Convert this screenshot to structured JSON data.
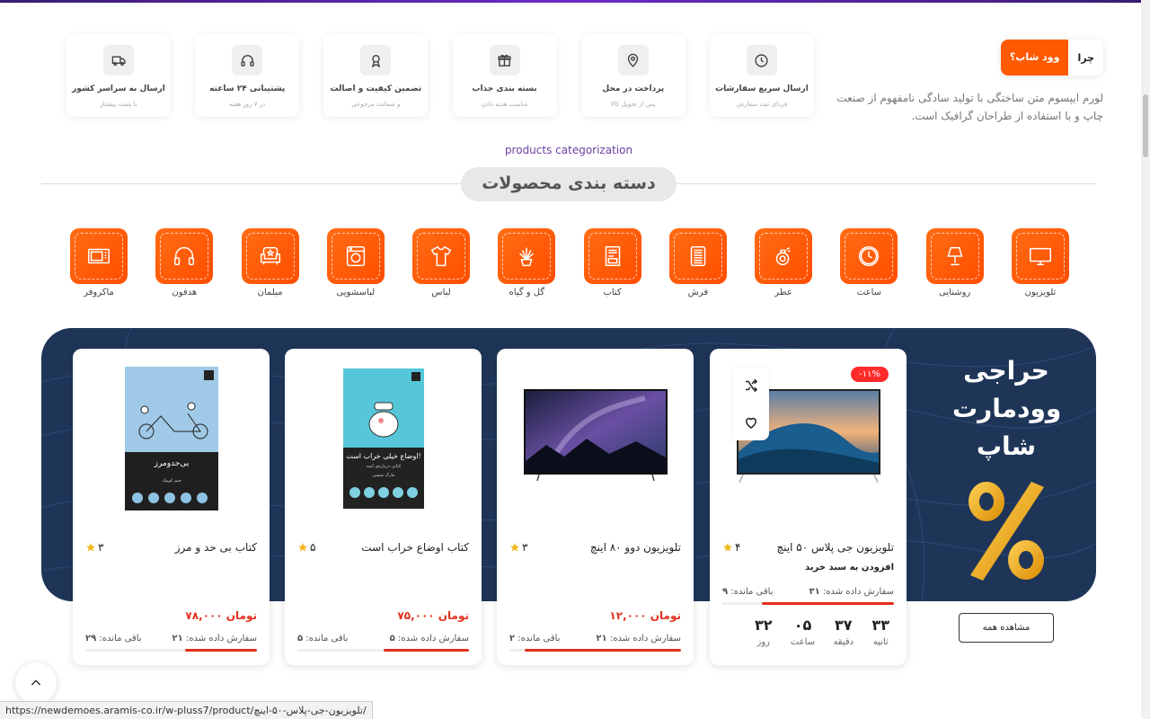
{
  "features": [
    {
      "icon": "clock-icon",
      "title": "ارسال سریع سفارشات",
      "subtitle": "فردای ثبت سفارش"
    },
    {
      "icon": "location-pin-icon",
      "title": "پرداخت در محل",
      "subtitle": "پس از تحویل کالا"
    },
    {
      "icon": "gift-icon",
      "title": "بسته بندی جذاب",
      "subtitle": "مناسب هدیه دادن"
    },
    {
      "icon": "award-icon",
      "title": "تضمین کیفیت و اصالت",
      "subtitle": "و ضمانت مرجوعی"
    },
    {
      "icon": "headphones-icon",
      "title": "پشتیبانی ۲۴ ساعته",
      "subtitle": "در ۷ روز هفته"
    },
    {
      "icon": "truck-icon",
      "title": "ارسال به سراسر کشور",
      "subtitle": "با پست پیشتاز"
    }
  ],
  "why": {
    "label": "چرا",
    "brand": "وود شاپ؟",
    "description": "لورم ایپسوم متن ساختگی با تولید سادگی نامفهوم از صنعت چاپ و با استفاده از طراحان گرافیک است."
  },
  "categories_section": {
    "subtitle": "products categorization",
    "title": "دسته بندی محصولات"
  },
  "categories": [
    {
      "label": "تلویزیون",
      "icon": "tv-icon"
    },
    {
      "label": "روشنایی",
      "icon": "lamp-icon"
    },
    {
      "label": "ساعت",
      "icon": "clock-icon"
    },
    {
      "label": "عطر",
      "icon": "perfume-icon"
    },
    {
      "label": "فرش",
      "icon": "rug-icon"
    },
    {
      "label": "کتاب",
      "icon": "book-icon"
    },
    {
      "label": "گل و گیاه",
      "icon": "plant-icon"
    },
    {
      "label": "لباس",
      "icon": "shirt-icon"
    },
    {
      "label": "لباسشویی",
      "icon": "washing-machine-icon"
    },
    {
      "label": "مبلمان",
      "icon": "sofa-icon"
    },
    {
      "label": "هدفون",
      "icon": "headphones-icon"
    },
    {
      "label": "ماکروفر",
      "icon": "microwave-icon"
    }
  ],
  "sale": {
    "title_lines": [
      "حراجی",
      "وودمارت",
      "شاپ"
    ],
    "view_all": "مشاهده همه",
    "featured": {
      "badge": "-۱۱%",
      "name": "تلویزیون جی پلاس ۵۰ اینچ",
      "rating": "۴",
      "add_to_cart": "افزودن به سبد خرید",
      "sold_label": "سفارش داده شده:",
      "sold": "۳۱",
      "left_label": "باقی مانده:",
      "left": "۹",
      "progress": 0.77,
      "countdown": [
        {
          "value": "۳۳",
          "label": "ثانیه"
        },
        {
          "value": "۳۷",
          "label": "دقیقه"
        },
        {
          "value": "۰۵",
          "label": "ساعت"
        },
        {
          "value": "۳۲",
          "label": "روز"
        }
      ]
    },
    "products": [
      {
        "name": "تلویزیون دوو ۸۰ اینچ",
        "rating": "۳",
        "price": "۱۲,۰۰۰ تومان",
        "sold_label": "سفارش داده شده:",
        "sold": "۲۱",
        "left_label": "باقی مانده:",
        "left": "۲",
        "progress": 0.91
      },
      {
        "name": "کتاب اوضاع خراب است",
        "rating": "۵",
        "price": "۷۵,۰۰۰ تومان",
        "sold_label": "سفارش داده شده:",
        "sold": "۵",
        "left_label": "باقی مانده:",
        "left": "۵",
        "progress": 0.5
      },
      {
        "name": "کتاب بی حد و مرز",
        "rating": "۳",
        "price": "۷۸,۰۰۰ تومان",
        "sold_label": "سفارش داده شده:",
        "sold": "۲۱",
        "left_label": "باقی مانده:",
        "left": "۲۹",
        "progress": 0.42
      }
    ],
    "book_covers": [
      {
        "title": "اوضاع خیلی خراب است!",
        "subtitle": "کتابی درباره‌ی امید",
        "author": "مارک منسن"
      },
      {
        "title": "بی‌حدومرز",
        "subtitle": "",
        "author": "جیم کوییک"
      }
    ]
  },
  "status_url": "https://newdemoes.aramis-co.ir/w-pluss7/product/تلویزیون-جی-پلاس-۵۰-اینچ/",
  "colors": {
    "accent": "#ff5a00",
    "banner": "#1f3558",
    "price": "#e3301c",
    "purple": "#6b3fa0"
  }
}
